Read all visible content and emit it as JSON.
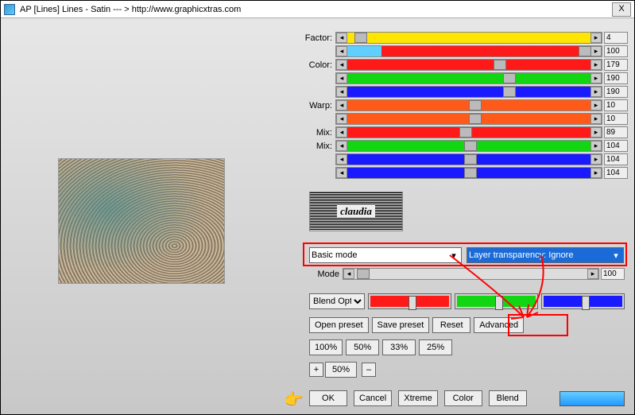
{
  "window": {
    "title": "AP [Lines]  Lines - Satin   --- > http://www.graphicxtras.com",
    "close": "X"
  },
  "sliders": [
    {
      "label": "Factor:",
      "cls": "yellow",
      "thumb": 3,
      "val": "4"
    },
    {
      "label": "",
      "cls": "cyan",
      "thumb": 95,
      "val": "100"
    },
    {
      "label": "Color:",
      "cls": "red",
      "thumb": 60,
      "val": "179"
    },
    {
      "label": "",
      "cls": "green",
      "thumb": 64,
      "val": "190"
    },
    {
      "label": "",
      "cls": "blue",
      "thumb": 64,
      "val": "190"
    },
    {
      "label": "Warp:",
      "cls": "orange",
      "thumb": 50,
      "val": "10"
    },
    {
      "label": "",
      "cls": "orange",
      "thumb": 50,
      "val": "10"
    },
    {
      "label": "Mix:",
      "cls": "red",
      "thumb": 46,
      "val": "89"
    },
    {
      "label": "Mix:",
      "cls": "green",
      "thumb": 48,
      "val": "104"
    },
    {
      "label": "",
      "cls": "blue",
      "thumb": 48,
      "val": "104"
    },
    {
      "label": "",
      "cls": "blue",
      "thumb": 48,
      "val": "104"
    }
  ],
  "logo": "claudia",
  "basic_mode": {
    "label": "Basic mode"
  },
  "layer_trans": {
    "label": "Layer transparency: Ignore"
  },
  "mode": {
    "label": "Mode",
    "val": "100"
  },
  "blend_option": "Blend Opti",
  "actions": {
    "open": "Open preset",
    "save": "Save preset",
    "reset": "Reset",
    "adv": "Advanced"
  },
  "percents": [
    "100%",
    "50%",
    "33%",
    "25%"
  ],
  "zoom": {
    "plus": "+",
    "val": "50%",
    "minus": "–"
  },
  "bottom": {
    "ok": "OK",
    "cancel": "Cancel",
    "xtreme": "Xtreme",
    "color": "Color",
    "blend": "Blend"
  }
}
